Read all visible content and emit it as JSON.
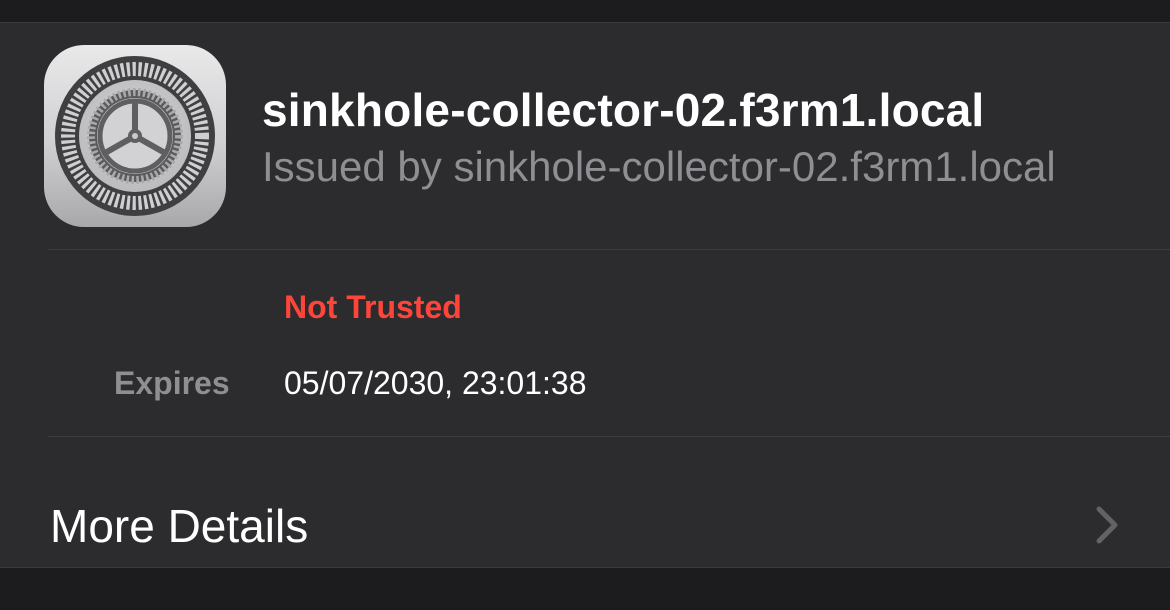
{
  "certificate": {
    "title": "sinkhole-collector-02.f3rm1.local",
    "issued_by": "Issued by sinkhole-collector-02.f3rm1.local",
    "icon": "settings-gear-icon"
  },
  "trust": {
    "status": "Not Trusted",
    "status_color": "#ff453a"
  },
  "expiry": {
    "label": "Expires",
    "value": "05/07/2030, 23:01:38"
  },
  "more_details": {
    "label": "More Details",
    "icon": "chevron-right-icon"
  },
  "colors": {
    "background": "#1c1c1e",
    "card": "#2c2c2e",
    "secondary_text": "#8e8e93"
  }
}
